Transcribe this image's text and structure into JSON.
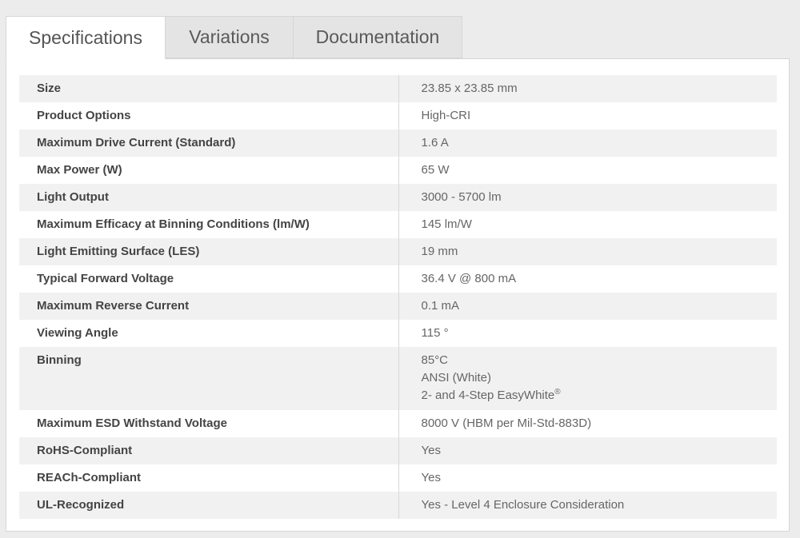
{
  "tabs": [
    {
      "label": "Specifications",
      "active": true
    },
    {
      "label": "Variations",
      "active": false
    },
    {
      "label": "Documentation",
      "active": false
    }
  ],
  "specs": [
    {
      "label": "Size",
      "value": "23.85 x 23.85 mm"
    },
    {
      "label": "Product Options",
      "value": "High-CRI"
    },
    {
      "label": "Maximum Drive Current (Standard)",
      "value": "1.6 A"
    },
    {
      "label": "Max Power (W)",
      "value": "65 W"
    },
    {
      "label": "Light Output",
      "value": "3000 - 5700 lm"
    },
    {
      "label": "Maximum Efficacy at Binning Conditions (lm/W)",
      "value": "145 lm/W"
    },
    {
      "label": "Light Emitting Surface (LES)",
      "value": "19 mm"
    },
    {
      "label": "Typical Forward Voltage",
      "value": "36.4 V @ 800 mA"
    },
    {
      "label": "Maximum Reverse Current",
      "value": "0.1 mA"
    },
    {
      "label": "Viewing Angle",
      "value": "115 °"
    },
    {
      "label": "Binning",
      "value_lines": [
        "85°C",
        "ANSI (White)",
        "2- and 4-Step EasyWhite"
      ],
      "value_sup": "®"
    },
    {
      "label": "Maximum ESD Withstand Voltage",
      "value": "8000 V (HBM per Mil-Std-883D)"
    },
    {
      "label": "RoHS-Compliant",
      "value": "Yes"
    },
    {
      "label": "REACh-Compliant",
      "value": "Yes"
    },
    {
      "label": "UL-Recognized",
      "value": "Yes - Level 4 Enclosure Consideration"
    }
  ]
}
